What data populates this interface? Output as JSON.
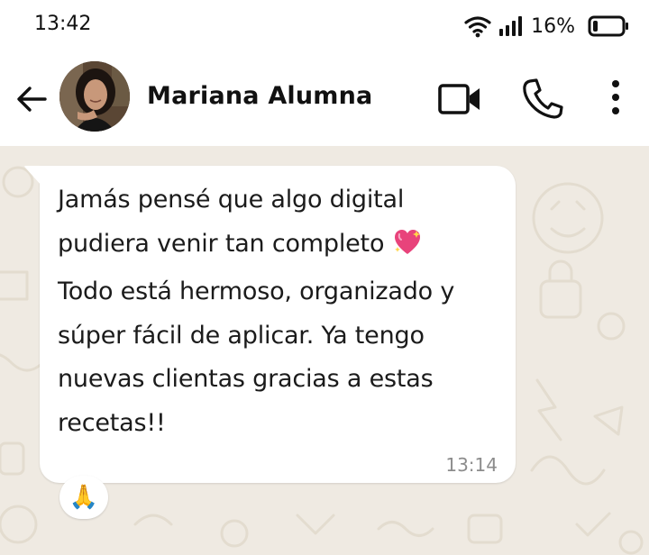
{
  "status_bar": {
    "time": "13:42",
    "battery_percent": "16%",
    "battery_level": 0.16
  },
  "header": {
    "contact_name": "Mariana Alumna",
    "back_icon": "arrow-left-icon",
    "video_icon": "video-camera-icon",
    "call_icon": "phone-icon",
    "menu_icon": "kebab-menu-icon"
  },
  "chat": {
    "message": {
      "lines": [
        "Jamás pensé que algo digital",
        "pudiera venir tan completo",
        "Todo está hermoso, organizado y",
        "súper fácil de aplicar. Ya tengo",
        "nuevas clientas gracias a estas",
        "recetas!!"
      ],
      "emoji_icon": "sparkling-heart-icon",
      "time": "13:14"
    },
    "reaction": {
      "emoji": "🙏",
      "icon": "folded-hands-icon"
    }
  },
  "colors": {
    "chat_background": "#efeae2",
    "bubble": "#ffffff",
    "heart": "#e8437b",
    "text": "#1b1b1b",
    "timestamp": "#8c8c8c"
  }
}
